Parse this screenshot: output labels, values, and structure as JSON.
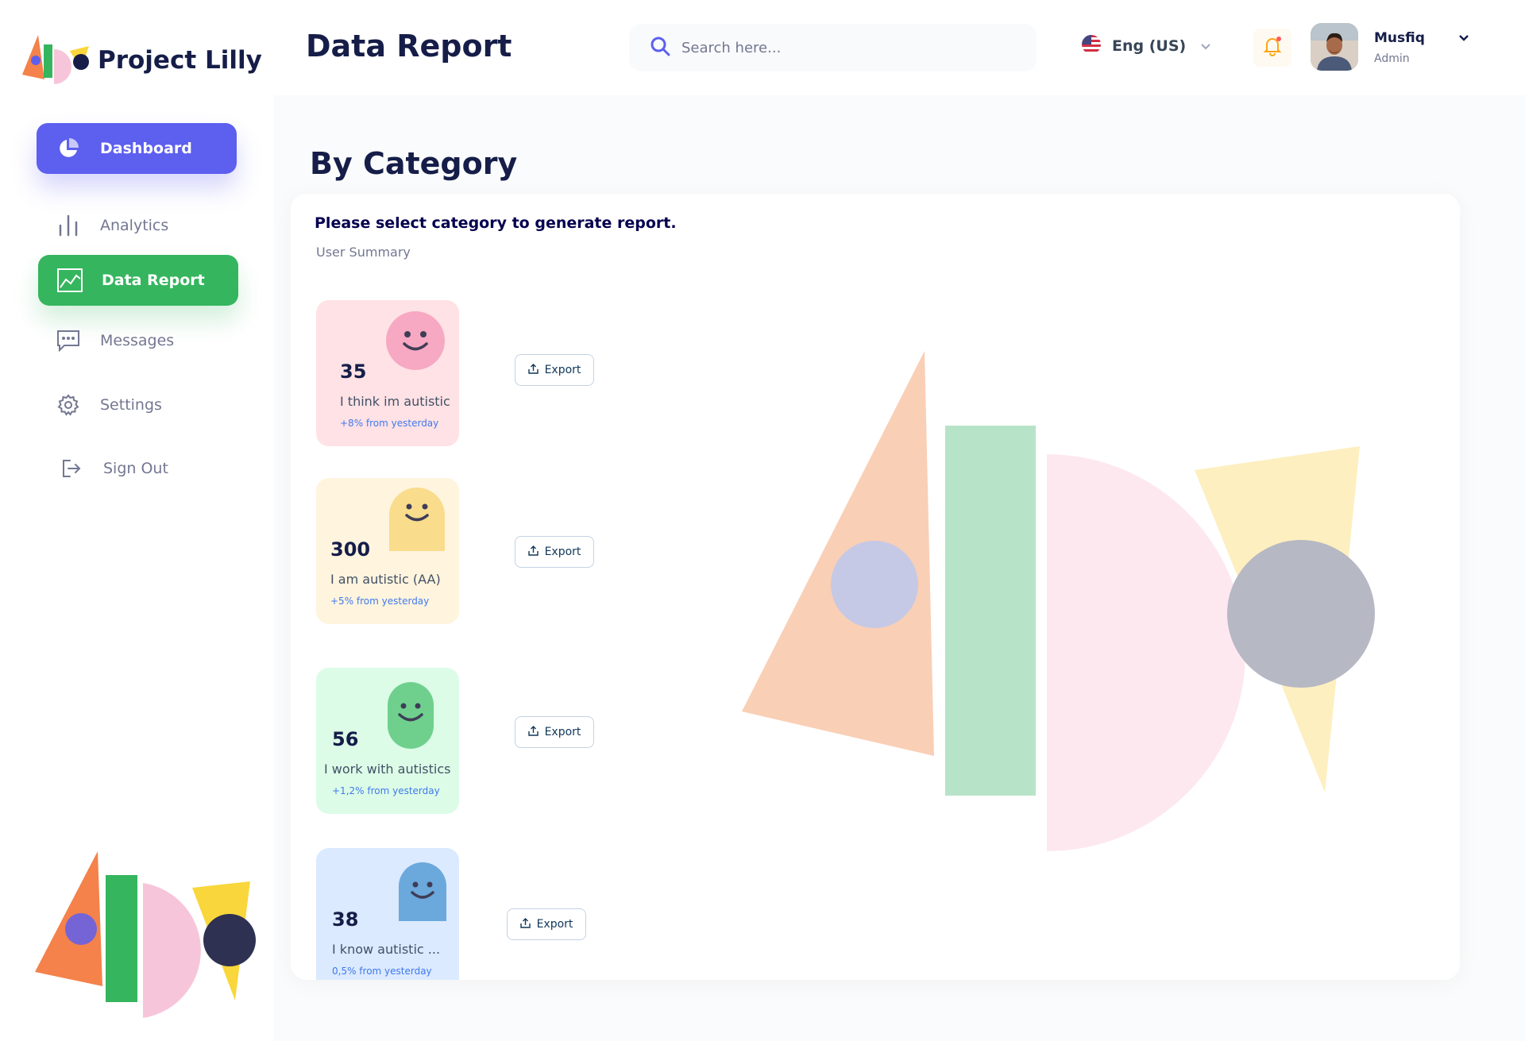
{
  "app": {
    "name": "Project Lilly"
  },
  "sidebar": {
    "items": [
      {
        "label": "Dashboard",
        "icon": "pie-chart-icon",
        "active": true
      },
      {
        "label": "Analytics",
        "icon": "bar-chart-icon"
      },
      {
        "label": "Data Report",
        "icon": "line-chart-icon",
        "active": true
      },
      {
        "label": "Messages",
        "icon": "message-icon"
      },
      {
        "label": "Settings",
        "icon": "gear-icon"
      },
      {
        "label": "Sign Out",
        "icon": "sign-out-icon"
      }
    ]
  },
  "header": {
    "title": "Data Report",
    "search_placeholder": "Search here...",
    "language": "Eng (US)",
    "user": {
      "name": "Musfiq",
      "role": "Admin"
    }
  },
  "main": {
    "section_title": "By Category",
    "panel_heading": "Please select category to generate report.",
    "panel_subheading": "User Summary",
    "export_label": "Export",
    "cards": [
      {
        "value": "35",
        "label": "I think im autistic",
        "delta": "+8% from yesterday",
        "bg": "#ffe2e5",
        "face": "#f7a8c3"
      },
      {
        "value": "300",
        "label": "I am autistic (AA)",
        "delta": "+5% from yesterday",
        "bg": "#fff4de",
        "face": "#f9dc8c"
      },
      {
        "value": "56",
        "label": "I work with autistics",
        "delta": "+1,2% from yesterday",
        "bg": "#dcfce7",
        "face": "#6fd08e"
      },
      {
        "value": "38",
        "label": "I know autistic ...",
        "delta": "0,5% from yesterday",
        "bg": "#dbeafe",
        "face": "#6ba8dc"
      }
    ]
  },
  "colors": {
    "primary": "#5d5fef",
    "green": "#35b55e",
    "orange": "#f4824a",
    "pink": "#f7c5d9",
    "yellow": "#f9d63b",
    "navy": "#2e3151"
  }
}
